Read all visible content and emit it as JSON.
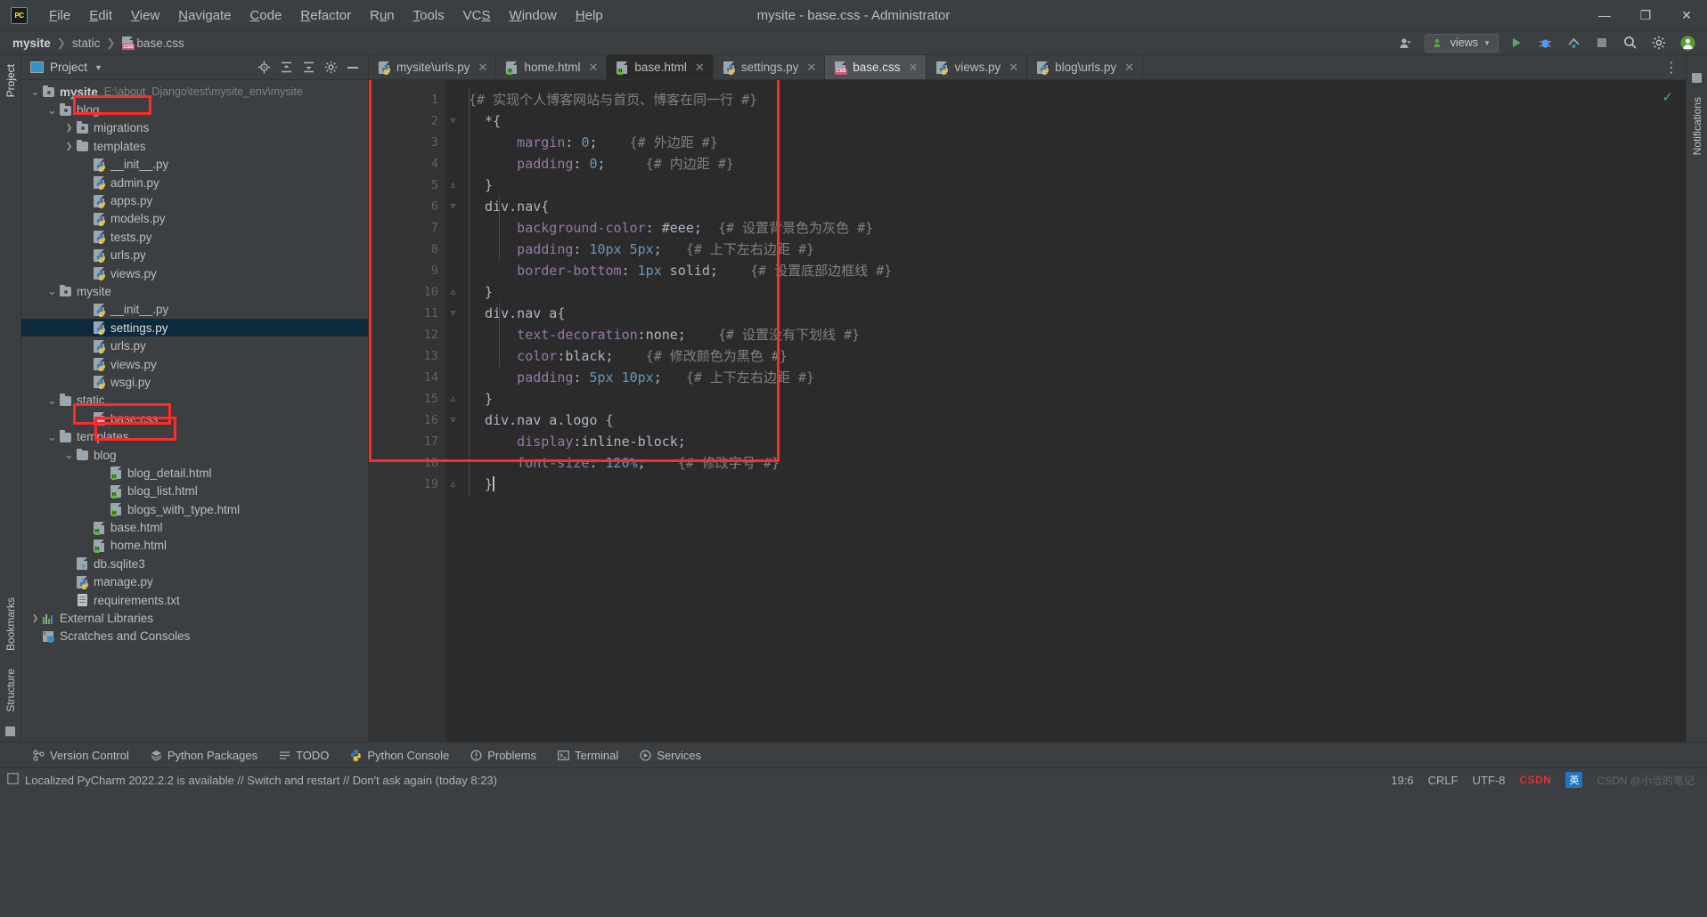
{
  "titlebar": {
    "logo": "PC",
    "window_title": "mysite - base.css - Administrator",
    "menu": [
      "File",
      "Edit",
      "View",
      "Navigate",
      "Code",
      "Refactor",
      "Run",
      "Tools",
      "VCS",
      "Window",
      "Help"
    ],
    "controls": {
      "minimize": "—",
      "maximize": "❐",
      "close": "✕"
    }
  },
  "breadcrumb": {
    "items": [
      "mysite",
      "static",
      "base.css"
    ],
    "separator": "❯",
    "run_config": "views",
    "right_icons": [
      "user-icon",
      "run-icon",
      "debug-icon",
      "coverage-icon",
      "stop-icon",
      "search-icon",
      "settings-icon",
      "account-icon"
    ]
  },
  "left_rail": {
    "labels": [
      "Project",
      "Bookmarks",
      "Structure"
    ]
  },
  "right_rail": {
    "labels": [
      "Notifications"
    ]
  },
  "project_panel": {
    "title": "Project",
    "actions": [
      "locate-icon",
      "expand-all-icon",
      "collapse-all-icon",
      "settings-icon",
      "hide-icon"
    ],
    "tree": [
      {
        "depth": 0,
        "twist": "⌄",
        "icon": "module-folder",
        "name": "mysite",
        "bold": true,
        "path": "E:\\about_Django\\test\\mysite_env\\mysite"
      },
      {
        "depth": 1,
        "twist": "⌄",
        "icon": "module-folder",
        "name": "blog"
      },
      {
        "depth": 2,
        "twist": "›",
        "icon": "module-folder",
        "name": "migrations"
      },
      {
        "depth": 2,
        "twist": "›",
        "icon": "folder",
        "name": "templates"
      },
      {
        "depth": 3,
        "twist": "",
        "icon": "python",
        "name": "__init__.py"
      },
      {
        "depth": 3,
        "twist": "",
        "icon": "python",
        "name": "admin.py"
      },
      {
        "depth": 3,
        "twist": "",
        "icon": "python",
        "name": "apps.py"
      },
      {
        "depth": 3,
        "twist": "",
        "icon": "python",
        "name": "models.py"
      },
      {
        "depth": 3,
        "twist": "",
        "icon": "python",
        "name": "tests.py"
      },
      {
        "depth": 3,
        "twist": "",
        "icon": "python",
        "name": "urls.py"
      },
      {
        "depth": 3,
        "twist": "",
        "icon": "python",
        "name": "views.py"
      },
      {
        "depth": 1,
        "twist": "⌄",
        "icon": "module-folder",
        "name": "mysite"
      },
      {
        "depth": 3,
        "twist": "",
        "icon": "python",
        "name": "__init__.py"
      },
      {
        "depth": 3,
        "twist": "",
        "icon": "python",
        "name": "settings.py",
        "selected": true
      },
      {
        "depth": 3,
        "twist": "",
        "icon": "python",
        "name": "urls.py"
      },
      {
        "depth": 3,
        "twist": "",
        "icon": "python",
        "name": "views.py"
      },
      {
        "depth": 3,
        "twist": "",
        "icon": "python",
        "name": "wsgi.py"
      },
      {
        "depth": 1,
        "twist": "⌄",
        "icon": "folder",
        "name": "static"
      },
      {
        "depth": 3,
        "twist": "",
        "icon": "css",
        "name": "base.css"
      },
      {
        "depth": 1,
        "twist": "⌄",
        "icon": "folder",
        "name": "templates"
      },
      {
        "depth": 2,
        "twist": "⌄",
        "icon": "folder",
        "name": "blog"
      },
      {
        "depth": 4,
        "twist": "",
        "icon": "html",
        "name": "blog_detail.html"
      },
      {
        "depth": 4,
        "twist": "",
        "icon": "html",
        "name": "blog_list.html"
      },
      {
        "depth": 4,
        "twist": "",
        "icon": "html",
        "name": "blogs_with_type.html"
      },
      {
        "depth": 3,
        "twist": "",
        "icon": "html",
        "name": "base.html"
      },
      {
        "depth": 3,
        "twist": "",
        "icon": "html",
        "name": "home.html"
      },
      {
        "depth": 2,
        "twist": "",
        "icon": "sqlite",
        "name": "db.sqlite3"
      },
      {
        "depth": 2,
        "twist": "",
        "icon": "python",
        "name": "manage.py"
      },
      {
        "depth": 2,
        "twist": "",
        "icon": "text",
        "name": "requirements.txt"
      },
      {
        "depth": 0,
        "twist": "›",
        "icon": "library",
        "name": "External Libraries"
      },
      {
        "depth": 0,
        "twist": "",
        "icon": "scratches",
        "name": "Scratches and Consoles"
      }
    ]
  },
  "editor": {
    "tabs": [
      {
        "label": "mysite\\urls.py",
        "icon": "python",
        "state": "normal"
      },
      {
        "label": "home.html",
        "icon": "html",
        "state": "normal"
      },
      {
        "label": "base.html",
        "icon": "html",
        "state": "active-dark"
      },
      {
        "label": "settings.py",
        "icon": "python",
        "state": "normal"
      },
      {
        "label": "base.css",
        "icon": "css",
        "state": "active-selected"
      },
      {
        "label": "views.py",
        "icon": "python",
        "state": "normal"
      },
      {
        "label": "blog\\urls.py",
        "icon": "python",
        "state": "normal"
      }
    ],
    "tab_close_glyph": "✕",
    "more_tabs_glyph": "⋮",
    "inspection_status": "✓",
    "line_numbers": [
      1,
      2,
      3,
      4,
      5,
      6,
      7,
      8,
      9,
      10,
      11,
      12,
      13,
      14,
      15,
      16,
      17,
      18,
      19
    ],
    "fold_markers": {
      "2": "▽",
      "5": "△",
      "6": "▽",
      "10": "△",
      "11": "▽",
      "15": "△",
      "16": "▽",
      "19": "△"
    },
    "code_lines": [
      [
        {
          "t": "{# 实现个人博客网站与首页、博客在同一行 #}",
          "c": "com"
        }
      ],
      [
        {
          "t": "  *{",
          "c": "sel"
        }
      ],
      [
        {
          "t": "      margin",
          "c": "prop"
        },
        {
          "t": ": ",
          "c": "punc"
        },
        {
          "t": "0",
          "c": "num"
        },
        {
          "t": ";",
          "c": "punc"
        },
        {
          "t": "    {# 外边距 #}",
          "c": "com"
        }
      ],
      [
        {
          "t": "      padding",
          "c": "prop"
        },
        {
          "t": ": ",
          "c": "punc"
        },
        {
          "t": "0",
          "c": "num"
        },
        {
          "t": ";",
          "c": "punc"
        },
        {
          "t": "     {# 内边距 #}",
          "c": "com"
        }
      ],
      [
        {
          "t": "  }",
          "c": "sel"
        }
      ],
      [
        {
          "t": "  div.nav{",
          "c": "sel"
        }
      ],
      [
        {
          "t": "      background-color",
          "c": "prop"
        },
        {
          "t": ": #eee;  ",
          "c": "val"
        },
        {
          "t": "{# 设置背景色为灰色 #}",
          "c": "com"
        }
      ],
      [
        {
          "t": "      padding",
          "c": "prop"
        },
        {
          "t": ": ",
          "c": "punc"
        },
        {
          "t": "10px 5px",
          "c": "num"
        },
        {
          "t": ";   ",
          "c": "punc"
        },
        {
          "t": "{# 上下左右边距 #}",
          "c": "com"
        }
      ],
      [
        {
          "t": "      border-bottom",
          "c": "prop"
        },
        {
          "t": ": ",
          "c": "punc"
        },
        {
          "t": "1px",
          "c": "num"
        },
        {
          "t": " solid;    ",
          "c": "val"
        },
        {
          "t": "{# 设置底部边框线 #}",
          "c": "com"
        }
      ],
      [
        {
          "t": "  }",
          "c": "sel"
        }
      ],
      [
        {
          "t": "  div.nav a{",
          "c": "sel"
        }
      ],
      [
        {
          "t": "      text-decoration",
          "c": "prop"
        },
        {
          "t": ":none;    ",
          "c": "val"
        },
        {
          "t": "{# 设置没有下划线 #}",
          "c": "com"
        }
      ],
      [
        {
          "t": "      color",
          "c": "prop"
        },
        {
          "t": ":black;    ",
          "c": "val"
        },
        {
          "t": "{# 修改颜色为黑色 #}",
          "c": "com"
        }
      ],
      [
        {
          "t": "      padding",
          "c": "prop"
        },
        {
          "t": ": ",
          "c": "punc"
        },
        {
          "t": "5px 10px",
          "c": "num"
        },
        {
          "t": ";   ",
          "c": "punc"
        },
        {
          "t": "{# 上下左右边距 #}",
          "c": "com"
        }
      ],
      [
        {
          "t": "  }",
          "c": "sel"
        }
      ],
      [
        {
          "t": "  div.nav a.logo {",
          "c": "sel"
        }
      ],
      [
        {
          "t": "      display",
          "c": "prop"
        },
        {
          "t": ":inline-block;",
          "c": "val"
        }
      ],
      [
        {
          "t": "      font-size",
          "c": "prop"
        },
        {
          "t": ": ",
          "c": "punc"
        },
        {
          "t": "120%",
          "c": "num"
        },
        {
          "t": ";    ",
          "c": "punc"
        },
        {
          "t": "{# 修改字号 #}",
          "c": "com"
        }
      ],
      [
        {
          "t": "  }",
          "c": "sel"
        }
      ]
    ]
  },
  "bottom_bar": {
    "items": [
      {
        "label": "Version Control",
        "icon": "branch-icon"
      },
      {
        "label": "Python Packages",
        "icon": "packages-icon"
      },
      {
        "label": "TODO",
        "icon": "todo-icon"
      },
      {
        "label": "Python Console",
        "icon": "python-icon"
      },
      {
        "label": "Problems",
        "icon": "problems-icon"
      },
      {
        "label": "Terminal",
        "icon": "terminal-icon"
      },
      {
        "label": "Services",
        "icon": "services-icon"
      }
    ]
  },
  "status_bar": {
    "message": "Localized PyCharm 2022.2.2 is available // Switch and restart // Don't ask again (today 8:23)",
    "caret_position": "19:6",
    "line_separator": "CRLF",
    "encoding": "UTF-8",
    "ime_lang": "英",
    "watermark": "CSDN @小浛的笔记"
  }
}
